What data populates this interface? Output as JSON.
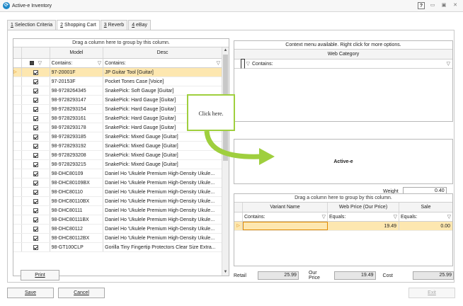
{
  "window": {
    "title": "Active-e Inventory",
    "help_label": "?"
  },
  "tabs": [
    {
      "underline": "1",
      "rest": " Selection Criteria"
    },
    {
      "underline": "2",
      "rest": " Shopping Cart"
    },
    {
      "underline": "3",
      "rest": " Reverb"
    },
    {
      "underline": "4",
      "rest": " eBay"
    }
  ],
  "left_grid": {
    "group_hint": "Drag a column here to group by this column.",
    "columns": {
      "model": "Model",
      "desc": "Desc"
    },
    "filter_model": "Contains:",
    "filter_desc": "Contains:",
    "rows": [
      {
        "model": "97-20001F",
        "desc": "JP Guitar Tool [Guitar]",
        "checked": true,
        "selected": true
      },
      {
        "model": "97-20153F",
        "desc": "Pocket Tones Case [Voice]",
        "checked": true
      },
      {
        "model": "98-9728264345",
        "desc": "SnakePick: Soft Gauge [Guitar]",
        "checked": true
      },
      {
        "model": "98-9728293147",
        "desc": "SnakePick: Hard Gauge [Guitar]",
        "checked": true
      },
      {
        "model": "98-9728293154",
        "desc": "SnakePick: Hard Gauge [Guitar]",
        "checked": true
      },
      {
        "model": "98-9728293161",
        "desc": "SnakePick: Hard Gauge [Guitar]",
        "checked": true
      },
      {
        "model": "98-9728293178",
        "desc": "SnakePick: Hard Gauge [Guitar]",
        "checked": true
      },
      {
        "model": "98-9728293185",
        "desc": "SnakePick: Mixed Gauge [Guitar]",
        "checked": true
      },
      {
        "model": "98-9728293192",
        "desc": "SnakePick: Mixed Gauge [Guitar]",
        "checked": true
      },
      {
        "model": "98-9728293208",
        "desc": "SnakePick: Mixed Gauge [Guitar]",
        "checked": true
      },
      {
        "model": "98-9728293215",
        "desc": "SnakePick: Mixed Gauge [Guitar]",
        "checked": true
      },
      {
        "model": "98-DHC80109",
        "desc": "Daniel Ho 'Ukulele Premium High-Density Ukule...",
        "checked": true
      },
      {
        "model": "98-DHC80109BX",
        "desc": "Daniel Ho 'Ukulele Premium High-Density Ukule...",
        "checked": true
      },
      {
        "model": "98-DHC80110",
        "desc": "Daniel Ho 'Ukulele Premium High-Density Ukule...",
        "checked": true
      },
      {
        "model": "98-DHC80110BX",
        "desc": "Daniel Ho 'Ukulele Premium High-Density Ukule...",
        "checked": true
      },
      {
        "model": "98-DHC80111",
        "desc": "Daniel Ho 'Ukulele Premium High-Density Ukule...",
        "checked": true
      },
      {
        "model": "98-DHC80111BX",
        "desc": "Daniel Ho 'Ukulele Premium High-Density Ukule...",
        "checked": true
      },
      {
        "model": "98-DHC80112",
        "desc": "Daniel Ho 'Ukulele Premium High-Density Ukule...",
        "checked": true
      },
      {
        "model": "98-DHC80112BX",
        "desc": "Daniel Ho 'Ukulele Premium High-Density Ukule...",
        "checked": true
      },
      {
        "model": "98-GT100CLP",
        "desc": "Gorilla Tiny Fingertip Protectors Clear Size Extra...",
        "checked": true
      }
    ]
  },
  "print_label": "Print",
  "web_category": {
    "context_hint": "Context menu available. Right click for more options.",
    "header": "Web Category",
    "filter": "Contains:"
  },
  "callout_text": "Click here.",
  "activee_label": "Active-e",
  "weight": {
    "label": "Weight",
    "value": "0.40"
  },
  "variants": {
    "group_hint": "Drag a column here to group by this column.",
    "columns": {
      "name": "Variant Name",
      "web_price": "Web Price (Our Price)",
      "sale": "Sale"
    },
    "filters": {
      "name": "Contains:",
      "web_price": "Equals:",
      "sale": "Equals:"
    },
    "row": {
      "name": "",
      "web_price": "19.49",
      "sale": "0.00"
    }
  },
  "prices": {
    "retail_label": "Retail",
    "retail_value": "25.99",
    "our_price_label": "Our Price",
    "our_price_value": "19.49",
    "cost_label": "Cost",
    "cost_value": "25.99"
  },
  "footer": {
    "save_label": "Save",
    "cancel_label": "Cancel",
    "exit_label": "Exit"
  },
  "colors": {
    "accent_green": "#9fcf3e",
    "selected_row": "#fde7b0",
    "row_marker": "#e08a00"
  }
}
